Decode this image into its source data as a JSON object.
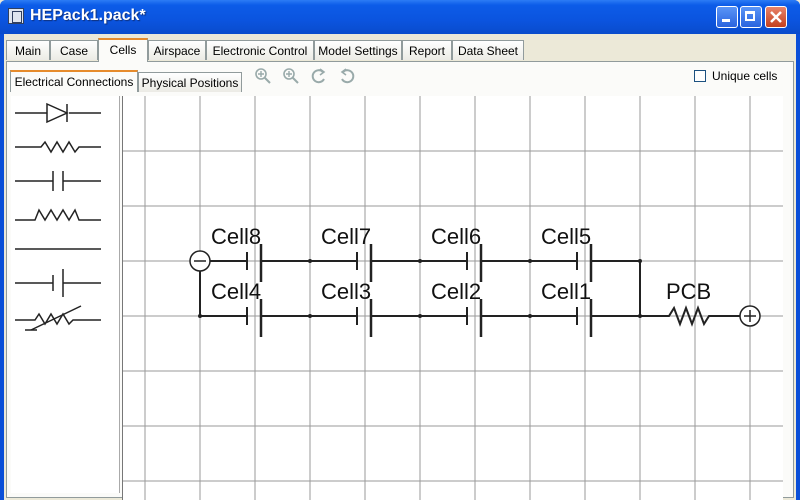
{
  "window": {
    "title": "HEPack1.pack*",
    "icon": "pack-icon",
    "controls": {
      "minimize": "minimize-icon",
      "maximize": "maximize-icon",
      "close": "close-icon"
    }
  },
  "main_tabs": [
    {
      "label": "Main",
      "active": false
    },
    {
      "label": "Case",
      "active": false
    },
    {
      "label": "Cells",
      "active": true
    },
    {
      "label": "Airspace",
      "active": false
    },
    {
      "label": "Electronic Control",
      "active": false
    },
    {
      "label": "Model Settings",
      "active": false
    },
    {
      "label": "Report",
      "active": false
    },
    {
      "label": "Data Sheet",
      "active": false
    }
  ],
  "sub_tabs": [
    {
      "label": "Electrical Connections",
      "active": true
    },
    {
      "label": "Physical Positions",
      "active": false
    }
  ],
  "toolbar": {
    "zoom_in": "zoom-in-icon",
    "zoom_in_2": "zoom-in-icon",
    "undo": "undo-icon",
    "redo": "redo-icon"
  },
  "options": {
    "unique_cells_label": "Unique cells",
    "unique_cells_checked": false
  },
  "palette": [
    {
      "symbol": "diode-icon"
    },
    {
      "symbol": "resistor-icon"
    },
    {
      "symbol": "capacitor-icon"
    },
    {
      "symbol": "inductor-icon"
    },
    {
      "symbol": "wire-icon"
    },
    {
      "symbol": "battery-cell-icon"
    },
    {
      "symbol": "variable-resistor-icon"
    }
  ],
  "schematic": {
    "top_row": [
      "Cell8",
      "Cell7",
      "Cell6",
      "Cell5"
    ],
    "bottom_row": [
      "Cell4",
      "Cell3",
      "Cell2",
      "Cell1"
    ],
    "pcb_label": "PCB",
    "negative_terminal": "minus-terminal-icon",
    "positive_terminal": "plus-terminal-icon"
  }
}
